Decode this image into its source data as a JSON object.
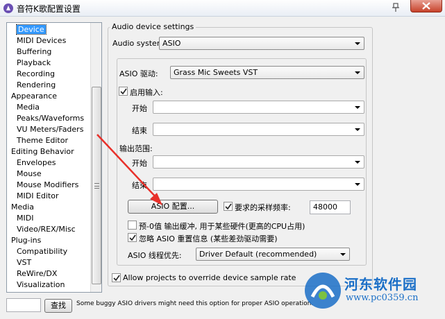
{
  "window": {
    "title": "音符K歌配置设置"
  },
  "tree": {
    "items": [
      {
        "label": "Device",
        "level": 1,
        "selected": true
      },
      {
        "label": "MIDI Devices",
        "level": 1
      },
      {
        "label": "Buffering",
        "level": 1
      },
      {
        "label": "Playback",
        "level": 1
      },
      {
        "label": "Recording",
        "level": 1
      },
      {
        "label": "Rendering",
        "level": 1
      },
      {
        "label": "Appearance",
        "level": 0
      },
      {
        "label": "Media",
        "level": 1
      },
      {
        "label": "Peaks/Waveforms",
        "level": 1
      },
      {
        "label": "VU Meters/Faders",
        "level": 1
      },
      {
        "label": "Theme Editor",
        "level": 1
      },
      {
        "label": "Editing Behavior",
        "level": 0
      },
      {
        "label": "Envelopes",
        "level": 1
      },
      {
        "label": "Mouse",
        "level": 1
      },
      {
        "label": "Mouse Modifiers",
        "level": 1
      },
      {
        "label": "MIDI Editor",
        "level": 1
      },
      {
        "label": "Media",
        "level": 0
      },
      {
        "label": "MIDI",
        "level": 1
      },
      {
        "label": "Video/REX/Misc",
        "level": 1
      },
      {
        "label": "Plug-ins",
        "level": 0
      },
      {
        "label": "Compatibility",
        "level": 1
      },
      {
        "label": "VST",
        "level": 1
      },
      {
        "label": "ReWire/DX",
        "level": 1
      },
      {
        "label": "Visualization",
        "level": 1
      }
    ]
  },
  "audio": {
    "group_title": "Audio device settings",
    "system_label": "Audio system:",
    "system_value": "ASIO",
    "asio_driver_label": "ASIO 驱动:",
    "asio_driver_value": "Grass Mic Sweets VST",
    "enable_input_label": "启用输入:",
    "enable_input_checked": true,
    "input_start_label": "开始",
    "input_end_label": "结束",
    "output_range_label": "输出范围:",
    "output_start_label": "开始",
    "output_end_label": "结束",
    "asio_config_button": "ASIO 配置...",
    "samplerate_label": "要求的采样频率:",
    "samplerate_checked": true,
    "samplerate_value": "48000",
    "prezero_label": "预-0值 输出缓冲, 用于某些硬件(更高的CPU占用)",
    "prezero_checked": false,
    "ignore_reset_label": "忽略 ASIO 重置信息 (某些差劲驱动需要)",
    "ignore_reset_checked": true,
    "thread_priority_label": "ASIO 线程优先:",
    "thread_priority_value": "Driver Default (recommended)",
    "override_label": "Allow projects to override device sample rate",
    "override_checked": true
  },
  "footer": {
    "search_value": "",
    "find_button": "查找",
    "hint": "Some buggy ASIO drivers might need this option for proper ASIO operation."
  },
  "watermark": {
    "name": "河东软件园",
    "url": "www.pc0359.cn"
  },
  "colors": {
    "selection": "#3399ff",
    "arrow": "#e8302a",
    "watermark": "#1b6fc7"
  }
}
